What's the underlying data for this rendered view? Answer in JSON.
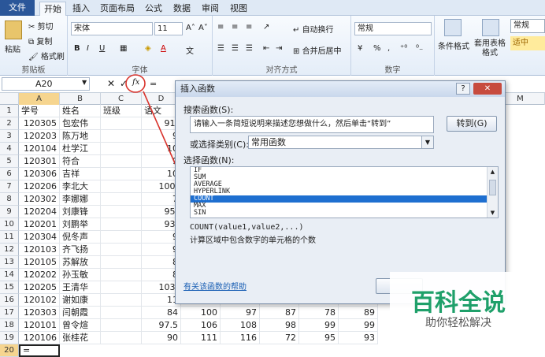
{
  "ribbon_tabs": [
    "文件",
    "开始",
    "插入",
    "页面布局",
    "公式",
    "数据",
    "审阅",
    "视图"
  ],
  "clipboard": {
    "paste": "粘贴",
    "cut": "剪切",
    "copy": "复制",
    "format_painter": "格式刷",
    "group": "剪贴板"
  },
  "font": {
    "name": "宋体",
    "size": "11",
    "group": "字体"
  },
  "alignment": {
    "wrap": "自动换行",
    "merge": "合并后居中",
    "group": "对齐方式"
  },
  "number": {
    "format": "常规",
    "group": "数字"
  },
  "styles": {
    "conditional": "条件格式",
    "table": "套用表格格式",
    "style_normal": "常规",
    "style_neutral": "适中"
  },
  "formula_bar": {
    "name_box": "A20",
    "formula": "="
  },
  "columns": [
    "A",
    "B",
    "C",
    "D",
    "E",
    "F",
    "G",
    "H",
    "I",
    "J",
    "K",
    "L",
    "M"
  ],
  "headers": [
    "学号",
    "姓名",
    "班级",
    "语文"
  ],
  "rows": [
    {
      "id": "120305",
      "name": "包宏伟",
      "d": "91.",
      "e": "",
      "f": "",
      "g": "",
      "h": "",
      "i": ""
    },
    {
      "id": "120203",
      "name": "陈万地",
      "d": "9",
      "e": "",
      "f": "",
      "g": "",
      "h": "",
      "i": ""
    },
    {
      "id": "120104",
      "name": "杜学江",
      "d": "10",
      "e": "",
      "f": "",
      "g": "",
      "h": "",
      "i": ""
    },
    {
      "id": "120301",
      "name": "符合",
      "d": "9",
      "e": "",
      "f": "",
      "g": "",
      "h": "",
      "i": ""
    },
    {
      "id": "120306",
      "name": "吉祥",
      "d": "10",
      "e": "",
      "f": "",
      "g": "",
      "h": "",
      "i": ""
    },
    {
      "id": "120206",
      "name": "李北大",
      "d": "100.",
      "e": "",
      "f": "",
      "g": "",
      "h": "",
      "i": ""
    },
    {
      "id": "120302",
      "name": "李娜娜",
      "d": "7",
      "e": "",
      "f": "",
      "g": "",
      "h": "",
      "i": ""
    },
    {
      "id": "120204",
      "name": "刘康锋",
      "d": "95.",
      "e": "",
      "f": "",
      "g": "",
      "h": "",
      "i": ""
    },
    {
      "id": "120201",
      "name": "刘鹏举",
      "d": "93.",
      "e": "",
      "f": "",
      "g": "",
      "h": "",
      "i": ""
    },
    {
      "id": "120304",
      "name": "倪冬声",
      "d": "9",
      "e": "",
      "f": "",
      "g": "",
      "h": "",
      "i": ""
    },
    {
      "id": "120103",
      "name": "齐飞扬",
      "d": "9",
      "e": "",
      "f": "",
      "g": "",
      "h": "",
      "i": ""
    },
    {
      "id": "120105",
      "name": "苏解放",
      "d": "8",
      "e": "",
      "f": "",
      "g": "",
      "h": "",
      "i": ""
    },
    {
      "id": "120202",
      "name": "孙玉敏",
      "d": "8",
      "e": "",
      "f": "",
      "g": "",
      "h": "",
      "i": ""
    },
    {
      "id": "120205",
      "name": "王清华",
      "d": "103.",
      "e": "",
      "f": "",
      "g": "",
      "h": "",
      "i": ""
    },
    {
      "id": "120102",
      "name": "谢如康",
      "d": "11",
      "e": "",
      "f": "",
      "g": "",
      "h": "",
      "i": ""
    },
    {
      "id": "120303",
      "name": "闫朝霞",
      "d": "84",
      "e": "100",
      "f": "97",
      "g": "87",
      "h": "78",
      "i": "89"
    },
    {
      "id": "120101",
      "name": "曾令煊",
      "d": "97.5",
      "e": "106",
      "f": "108",
      "g": "98",
      "h": "99",
      "i": "99"
    },
    {
      "id": "120106",
      "name": "张桂花",
      "d": "90",
      "e": "111",
      "f": "116",
      "g": "72",
      "h": "95",
      "i": "93"
    }
  ],
  "active_cell": "=",
  "dialog": {
    "title": "插入函数",
    "search_label": "搜索函数(S):",
    "search_value": "请输入一条简短说明来描述您想做什么，然后单击“转到”",
    "go_button": "转到(G)",
    "category_label": "或选择类别(C):",
    "category_value": "常用函数",
    "select_label": "选择函数(N):",
    "functions": [
      "IF",
      "SUM",
      "AVERAGE",
      "HYPERLINK",
      "COUNT",
      "MAX",
      "SIN"
    ],
    "selected": "COUNT",
    "syntax": "COUNT(value1,value2,...)",
    "description": "计算区域中包含数字的单元格的个数",
    "help_link": "有关该函数的帮助"
  },
  "watermark": {
    "title": "百科全说",
    "subtitle": "助你轻松解决"
  },
  "colors": {
    "file_tab": "#2a5699",
    "selection": "#1e6fd0",
    "highlight": "#f6d58f",
    "annotation": "#d9332c"
  }
}
